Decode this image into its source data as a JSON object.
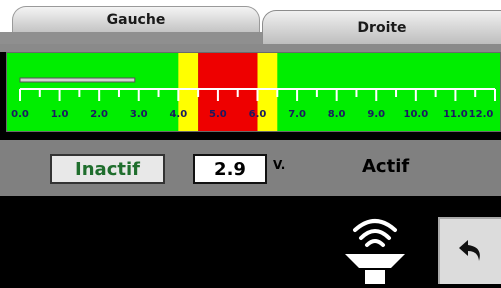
{
  "tabs": [
    {
      "label": "Gauche",
      "active": false
    },
    {
      "label": "Droite",
      "active": true
    }
  ],
  "scale": {
    "ticks": [
      "0.0",
      "1.0",
      "2.0",
      "3.0",
      "4.0",
      "5.0",
      "6.0",
      "7.0",
      "8.0",
      "9.0",
      "10.0",
      "11.0",
      "12.0"
    ],
    "min": 0.0,
    "max": 12.0,
    "red_zone": [
      4.5,
      6.0
    ],
    "yellow_zones": [
      [
        4.0,
        4.5
      ],
      [
        6.0,
        6.5
      ]
    ],
    "current_value": 2.9,
    "colors": {
      "background": "#00ee00",
      "red": "#ee0000",
      "yellow": "#ffff00"
    }
  },
  "controls": {
    "inactive_label": "Inactif",
    "value": "2.9",
    "unit": "V.",
    "active_label": "Actif"
  },
  "icons": {
    "lamp": "wifi-lamp-icon",
    "back": "undo-arrow-icon"
  }
}
